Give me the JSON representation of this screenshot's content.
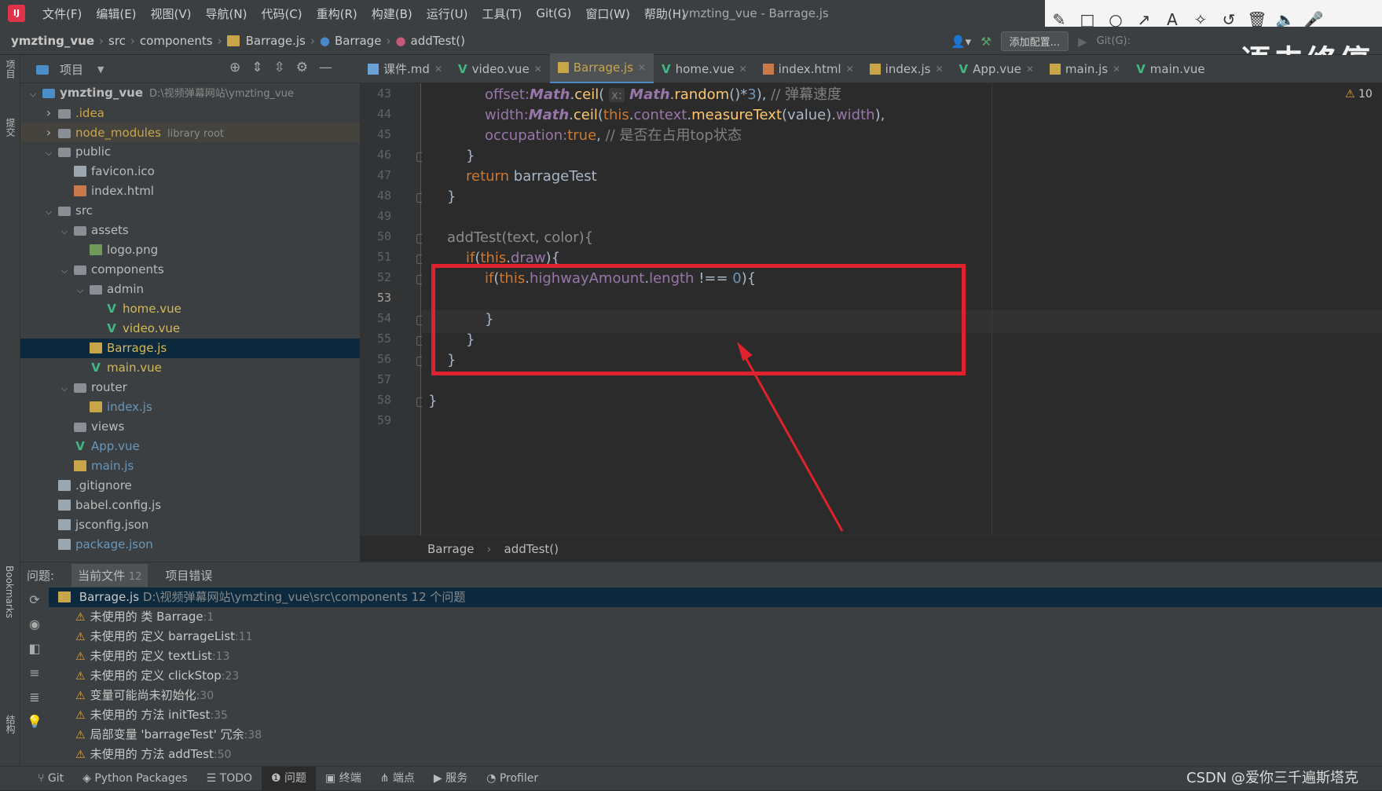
{
  "menubar": {
    "items": [
      "文件(F)",
      "编辑(E)",
      "视图(V)",
      "导航(N)",
      "代码(C)",
      "重构(R)",
      "构建(B)",
      "运行(U)",
      "工具(T)",
      "Git(G)",
      "窗口(W)",
      "帮助(H)"
    ],
    "window_title": "ymzting_vue - Barrage.js"
  },
  "navbar": {
    "crumbs": [
      "ymzting_vue",
      "src",
      "components",
      "Barrage.js",
      "Barrage",
      "addTest()"
    ],
    "add_config_label": "添加配置...",
    "git_label": "Git(G):"
  },
  "watermark_top": "语未终停",
  "project_panel": {
    "title": "项目",
    "tree": [
      {
        "label": "ymzting_vue",
        "extra": "D:\\视频弹幕网站\\ymzting_vue",
        "depth": 0,
        "arrow": "v",
        "icon": "folder-proj"
      },
      {
        "label": ".idea",
        "depth": 1,
        "arrow": ">",
        "icon": "folder"
      },
      {
        "label": "node_modules",
        "extra": "library root",
        "depth": 1,
        "arrow": ">",
        "icon": "folder"
      },
      {
        "label": "public",
        "depth": 1,
        "arrow": "v",
        "icon": "folder"
      },
      {
        "label": "favicon.ico",
        "depth": 2,
        "arrow": "",
        "icon": "file"
      },
      {
        "label": "index.html",
        "depth": 2,
        "arrow": "",
        "icon": "html"
      },
      {
        "label": "src",
        "depth": 1,
        "arrow": "v",
        "icon": "folder"
      },
      {
        "label": "assets",
        "depth": 2,
        "arrow": "v",
        "icon": "folder"
      },
      {
        "label": "logo.png",
        "depth": 3,
        "arrow": "",
        "icon": "png"
      },
      {
        "label": "components",
        "depth": 2,
        "arrow": "v",
        "icon": "folder"
      },
      {
        "label": "admin",
        "depth": 3,
        "arrow": "v",
        "icon": "folder"
      },
      {
        "label": "home.vue",
        "depth": 4,
        "arrow": "",
        "icon": "vue"
      },
      {
        "label": "video.vue",
        "depth": 4,
        "arrow": "",
        "icon": "vue"
      },
      {
        "label": "Barrage.js",
        "depth": 3,
        "arrow": "",
        "icon": "js"
      },
      {
        "label": "main.vue",
        "depth": 3,
        "arrow": "",
        "icon": "vue"
      },
      {
        "label": "router",
        "depth": 2,
        "arrow": "v",
        "icon": "folder"
      },
      {
        "label": "index.js",
        "depth": 3,
        "arrow": "",
        "icon": "js"
      },
      {
        "label": "views",
        "depth": 2,
        "arrow": "",
        "icon": "folder"
      },
      {
        "label": "App.vue",
        "depth": 2,
        "arrow": "",
        "icon": "vue"
      },
      {
        "label": "main.js",
        "depth": 2,
        "arrow": "",
        "icon": "js"
      },
      {
        "label": ".gitignore",
        "depth": 1,
        "arrow": "",
        "icon": "file"
      },
      {
        "label": "babel.config.js",
        "depth": 1,
        "arrow": "",
        "icon": "file"
      },
      {
        "label": "jsconfig.json",
        "depth": 1,
        "arrow": "",
        "icon": "file"
      },
      {
        "label": "package.json",
        "depth": 1,
        "arrow": "",
        "icon": "file"
      }
    ]
  },
  "editor_tabs": [
    {
      "label": "课件.md",
      "icon": "md"
    },
    {
      "label": "video.vue",
      "icon": "vue"
    },
    {
      "label": "Barrage.js",
      "icon": "js",
      "active": true
    },
    {
      "label": "home.vue",
      "icon": "vue"
    },
    {
      "label": "index.html",
      "icon": "html"
    },
    {
      "label": "index.js",
      "icon": "js"
    },
    {
      "label": "App.vue",
      "icon": "vue"
    },
    {
      "label": "main.js",
      "icon": "js"
    },
    {
      "label": "main.vue",
      "icon": "vue"
    }
  ],
  "editor": {
    "line_numbers": [
      "43",
      "44",
      "45",
      "46",
      "47",
      "48",
      "49",
      "50",
      "51",
      "52",
      "53",
      "54",
      "55",
      "56",
      "57",
      "58",
      "59"
    ],
    "current_line": "53",
    "warning_count": "10",
    "code": {
      "l43a": "offset:",
      "l43b": "Math",
      "l43c": ".",
      "l43d": "ceil",
      "l43e": "( ",
      "l43hint": "x:",
      "l43f": " Math",
      "l43g": ".",
      "l43h": "random",
      "l43i": "()*",
      "l43j": "3",
      "l43k": "), ",
      "l43l": "// 弹幕速度",
      "l44a": "width:",
      "l44b": "Math",
      "l44c": ".",
      "l44d": "ceil",
      "l44e": "(",
      "l44f": "this",
      "l44g": ".",
      "l44h": "context",
      "l44i": ".",
      "l44j": "measureText",
      "l44k": "(value).",
      "l44l": "width",
      "l44m": "),",
      "l45a": "occupation:",
      "l45b": "true",
      "l45c": ", ",
      "l45d": "// 是否在占用top状态",
      "l46": "}",
      "l47a": "return",
      "l47b": " barrageTest",
      "l48": "}",
      "l50a": "addTest",
      "l50b": "(text, color){",
      "l51a": "if",
      "l51b": "(",
      "l51c": "this",
      "l51d": ".",
      "l51e": "draw",
      "l51f": "){",
      "l52a": "if",
      "l52b": "(",
      "l52c": "this",
      "l52d": ".",
      "l52e": "highwayAmount",
      "l52f": ".",
      "l52g": "length",
      "l52h": " !== ",
      "l52i": "0",
      "l52j": "){",
      "l54": "}",
      "l55": "}",
      "l56": "}",
      "l58": "}"
    },
    "breadcrumb": [
      "Barrage",
      "addTest()"
    ]
  },
  "problems": {
    "label": "问题:",
    "tabs": [
      {
        "label": "当前文件",
        "count": "12"
      },
      {
        "label": "项目错误",
        "count": ""
      }
    ],
    "file_row": {
      "file": "Barrage.js",
      "path": "D:\\视频弹幕网站\\ymzting_vue\\src\\components",
      "summary": "12 个问题"
    },
    "items": [
      {
        "text": "未使用的 类 Barrage",
        "line": ":1"
      },
      {
        "text": "未使用的 定义 barrageList",
        "line": ":11"
      },
      {
        "text": "未使用的 定义 textList",
        "line": ":13"
      },
      {
        "text": "未使用的 定义 clickStop",
        "line": ":23"
      },
      {
        "text": "变量可能尚未初始化",
        "line": ":30"
      },
      {
        "text": "未使用的 方法 initTest",
        "line": ":35"
      },
      {
        "text": "局部变量 'barrageTest' 冗余",
        "line": ":38"
      },
      {
        "text": "未使用的 方法 addTest",
        "line": ":50"
      }
    ]
  },
  "left_strip": {
    "project": "项目",
    "commit": "提交",
    "bookmarks": "Bookmarks",
    "structure": "结构"
  },
  "statusbar": {
    "items": [
      "Git",
      "Python Packages",
      "TODO",
      "问题",
      "终端",
      "端点",
      "服务",
      "Profiler"
    ],
    "watermark": "CSDN @爱你三千遍斯塔克"
  },
  "colors": {
    "annotation": "#e0212e",
    "accent": "#4a88c7",
    "keyword": "#cc7832",
    "property": "#9876aa"
  }
}
